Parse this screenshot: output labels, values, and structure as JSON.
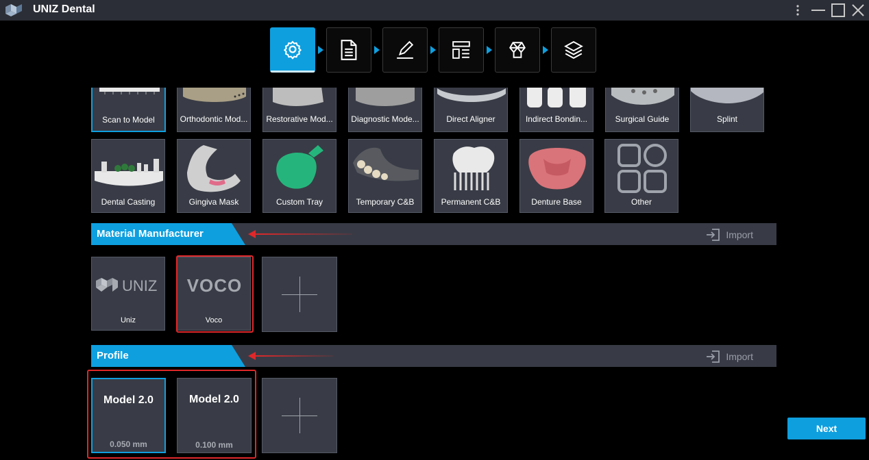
{
  "window": {
    "title": "UNIZ Dental"
  },
  "steps": [
    {
      "icon": "gear-icon",
      "active": true
    },
    {
      "icon": "document-icon",
      "active": false
    },
    {
      "icon": "pencil-icon",
      "active": false
    },
    {
      "icon": "layout-icon",
      "active": false
    },
    {
      "icon": "tooth-outline-icon",
      "active": false
    },
    {
      "icon": "layers-icon",
      "active": false
    }
  ],
  "applications": {
    "row1": [
      "Scan to Model",
      "Orthodontic Mod...",
      "Restorative Mod...",
      "Diagnostic Mode...",
      "Direct Aligner",
      "Indirect Bondin...",
      "Surgical Guide",
      "Splint"
    ],
    "row2": [
      "Dental Casting",
      "Gingiva Mask",
      "Custom Tray",
      "Temporary C&B",
      "Permanent C&B",
      "Denture Base",
      "Other"
    ],
    "selected": "Scan to Model"
  },
  "material_manufacturer": {
    "title": "Material Manufacturer",
    "import_label": "Import",
    "items": [
      {
        "label": "Uniz",
        "logo_text": "UNIZ"
      },
      {
        "label": "Voco",
        "logo_text": "VOCO"
      }
    ]
  },
  "profile": {
    "title": "Profile",
    "import_label": "Import",
    "items": [
      {
        "title": "Model 2.0",
        "layer": "0.050 mm"
      },
      {
        "title": "Model 2.0",
        "layer": "0.100 mm"
      }
    ]
  },
  "footer": {
    "next_label": "Next"
  },
  "colors": {
    "accent": "#0e9fdf",
    "annotation": "#e0282a",
    "card": "#393c46"
  }
}
